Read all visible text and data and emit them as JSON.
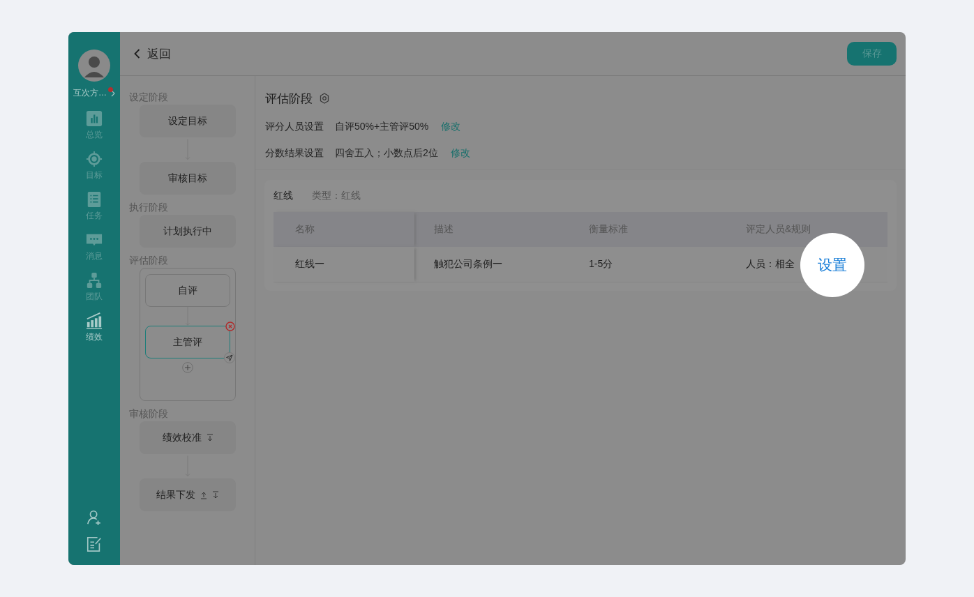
{
  "user": {
    "name": "互次方…",
    "notification": true
  },
  "nav": [
    {
      "label": "总览",
      "selected": false
    },
    {
      "label": "目标",
      "selected": false
    },
    {
      "label": "任务",
      "selected": false
    },
    {
      "label": "消息",
      "selected": false
    },
    {
      "label": "团队",
      "selected": false
    },
    {
      "label": "绩效",
      "selected": true
    }
  ],
  "header": {
    "back": "返回",
    "save": "保存"
  },
  "flow": [
    {
      "kind": "stage",
      "label": "设定阶段"
    },
    {
      "kind": "node",
      "label": "设定目标"
    },
    {
      "kind": "node",
      "label": "审核目标"
    },
    {
      "kind": "stage",
      "label": "执行阶段"
    },
    {
      "kind": "node",
      "label": "计划执行中"
    },
    {
      "kind": "stage",
      "label": "评估阶段"
    },
    {
      "kind": "group",
      "nodes": [
        {
          "label": "自评",
          "selected": false
        },
        {
          "label": "主管评",
          "selected": true
        }
      ]
    },
    {
      "kind": "stage",
      "label": "审核阶段"
    },
    {
      "kind": "node",
      "label": "绩效校准",
      "move_up": false,
      "move_down": true
    },
    {
      "kind": "node",
      "label": "结果下发",
      "move_up": true,
      "move_down": true
    }
  ],
  "content": {
    "title": "评估阶段",
    "settings": [
      {
        "label": "评分人员设置",
        "value": "自评50%+主管评50%",
        "link": "修改"
      },
      {
        "label": "分数结果设置",
        "value": "四舍五入；小数点后2位",
        "link": "修改"
      }
    ],
    "card": {
      "title": "红线",
      "type": "类型：红线",
      "columns": [
        "名称",
        "描述",
        "衡量标准",
        "评定人员&规则"
      ],
      "rows": [
        [
          "红线一",
          "触犯公司条例一",
          "1-5分",
          "人员：相全"
        ]
      ]
    },
    "spotlight": "设置"
  }
}
